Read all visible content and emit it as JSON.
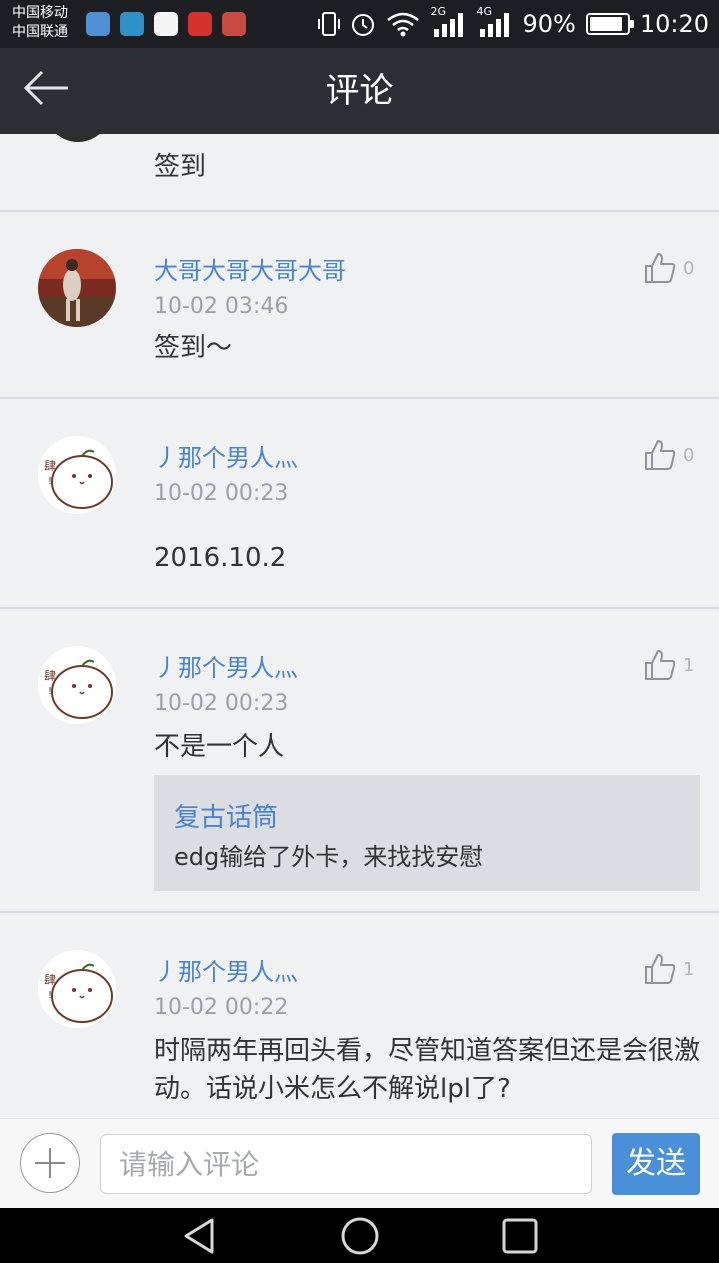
{
  "status_bar": {
    "carrier_1": "中国移动",
    "carrier_2": "中国联通",
    "network_2g": "2G",
    "network_4g": "4G",
    "battery": "90%",
    "battery_level": 0.9,
    "time": "10:20"
  },
  "header": {
    "title": "评论"
  },
  "partial_comment": {
    "text": "签到"
  },
  "comments": [
    {
      "user": "大哥大哥大哥大哥",
      "time": "10-02 03:46",
      "text": "签到～",
      "likes": "0"
    },
    {
      "user": "丿那个男人灬",
      "time": "10-02 00:23",
      "text": "2016.10.2",
      "likes": "0"
    },
    {
      "user": "丿那个男人灬",
      "time": "10-02 00:23",
      "text": "不是一个人",
      "likes": "1",
      "quote": {
        "user": "复古话筒",
        "text": "edg输给了外卡，来找找安慰"
      }
    },
    {
      "user": "丿那个男人灬",
      "time": "10-02 00:22",
      "text": "时隔两年再回头看，尽管知道答案但还是会很激动。话说小米怎么不解说lpl了?",
      "likes": "1"
    }
  ],
  "input_bar": {
    "placeholder": "请输入评论",
    "send_label": "发送"
  },
  "colors": {
    "accent": "#4a84d1",
    "send_button": "#4a90d9",
    "header_bg": "#2b2f34"
  }
}
